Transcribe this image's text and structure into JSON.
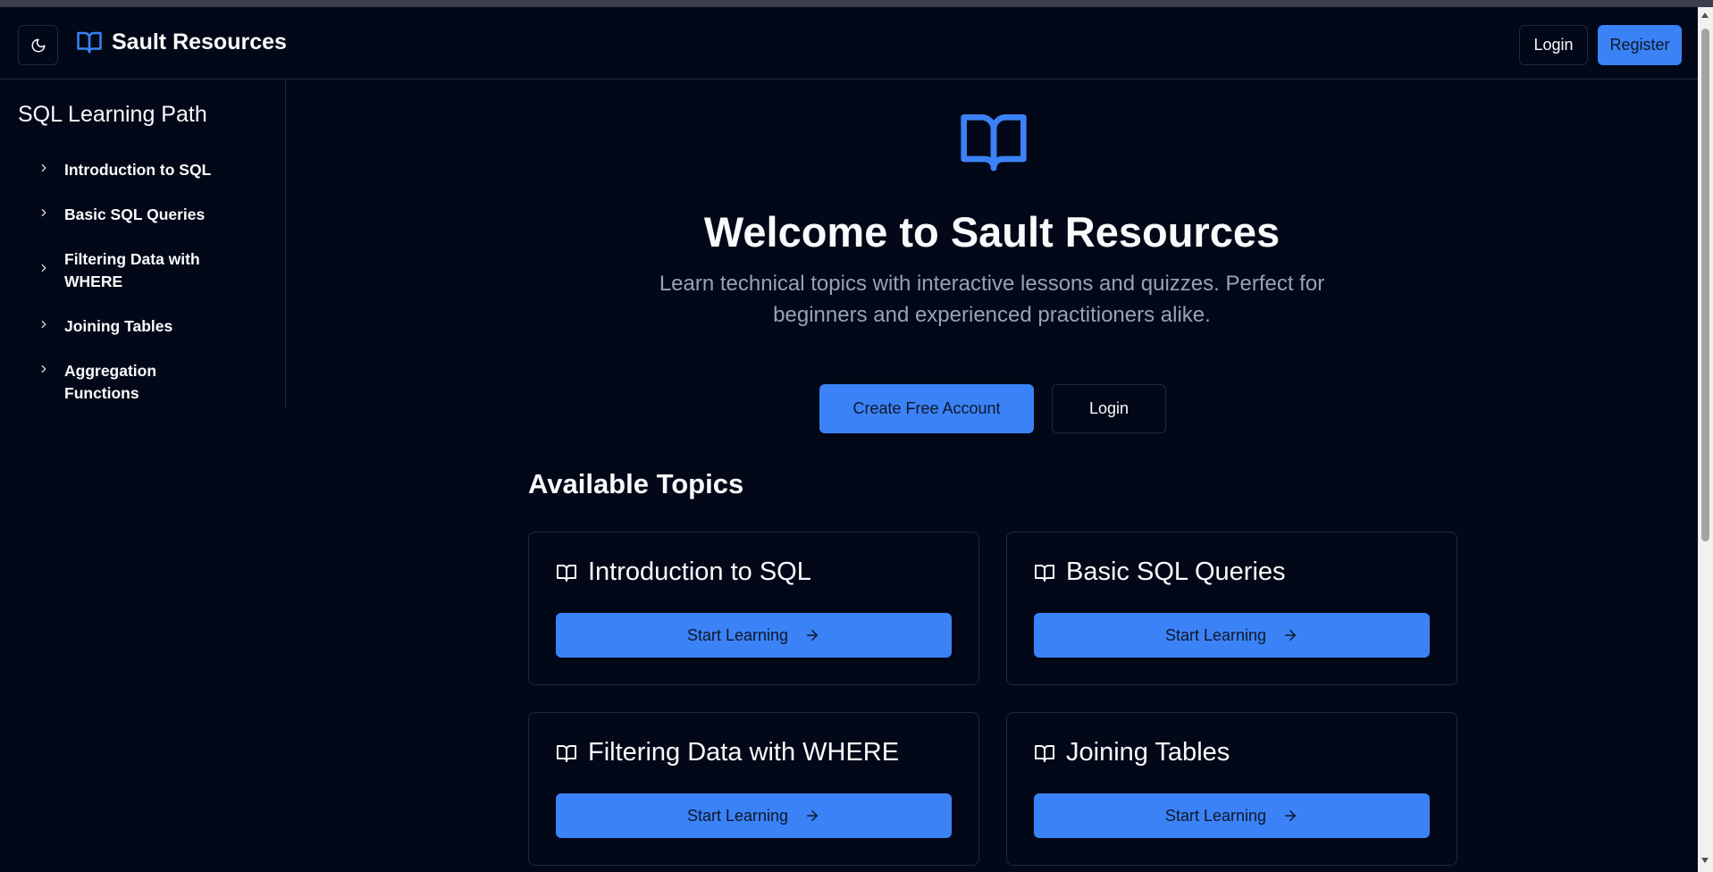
{
  "header": {
    "brand": "Sault Resources",
    "login_label": "Login",
    "register_label": "Register"
  },
  "sidebar": {
    "title": "SQL Learning Path",
    "items": [
      {
        "label": "Introduction to SQL"
      },
      {
        "label": "Basic SQL Queries"
      },
      {
        "label": "Filtering Data with WHERE"
      },
      {
        "label": "Joining Tables"
      },
      {
        "label": "Aggregation Functions"
      }
    ]
  },
  "hero": {
    "title": "Welcome to Sault Resources",
    "subtitle": "Learn technical topics with interactive lessons and quizzes. Perfect for beginners and experienced practitioners alike.",
    "primary_cta": "Create Free Account",
    "secondary_cta": "Login"
  },
  "topics": {
    "title": "Available Topics",
    "cards": [
      {
        "title": "Introduction to SQL",
        "button": "Start Learning"
      },
      {
        "title": "Basic SQL Queries",
        "button": "Start Learning"
      },
      {
        "title": "Filtering Data with WHERE",
        "button": "Start Learning"
      },
      {
        "title": "Joining Tables",
        "button": "Start Learning"
      }
    ]
  },
  "colors": {
    "background": "#020817",
    "accent": "#3b82f6",
    "border": "#1e293b",
    "muted_text": "#94a3b8"
  },
  "icons": {
    "theme_toggle": "moon-icon",
    "brand": "book-open-icon",
    "sidebar_item": "chevron-right-icon",
    "card": "book-open-icon",
    "card_button": "arrow-right-icon"
  }
}
